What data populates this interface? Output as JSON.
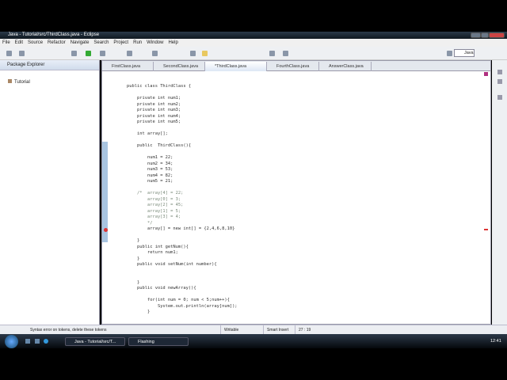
{
  "window": {
    "title": "Java - Tutorial/src/ThirdClass.java - Eclipse"
  },
  "menu": [
    "File",
    "Edit",
    "Source",
    "Refactor",
    "Navigate",
    "Search",
    "Project",
    "Run",
    "Window",
    "Help"
  ],
  "perspective": "Java",
  "package_explorer": {
    "title": "Package Explorer",
    "items": [
      "Tutorial"
    ]
  },
  "tabs": [
    "FirstClass.java",
    "SecondClass.java",
    "*ThirdClass.java",
    "FourthClass.java",
    "AnswerClass.java"
  ],
  "code": [
    "public class ThirdClass {",
    "",
    "    private int num1;",
    "    private int num2;",
    "    private int num3;",
    "    private int num4;",
    "    private int num5;",
    "",
    "    int array[];",
    "",
    "    public  ThirdClass(){",
    "",
    "        num1 = 22;",
    "        num2 = 34;",
    "        num3 = 53;",
    "        num4 = 82;",
    "        num5 = 21;",
    "",
    "    /*  array[4] = 22;",
    "        array[0] = 3;",
    "        array[2] = 45;",
    "        array[1] = 5;",
    "        array[3] = 4;",
    "        */",
    "        array[] = new int[] = {2,4,6,8,10}",
    "",
    "    }",
    "    public int getNum(){",
    "        return num1;",
    "    }",
    "    public void setNum(int number){",
    "",
    "",
    "    }",
    "    public void newArray(){",
    "",
    "        for(int num = 0; num < 5;num++){",
    "            System.out.println(array[num]);",
    "        }"
  ],
  "status": {
    "message": "Syntax error on tokens, delete these tokens",
    "writable": "Writable",
    "insert_mode": "Smart Insert",
    "position": "27 : 19"
  },
  "taskbar": {
    "tasks": [
      "Java - Tutorial/src/T...",
      "Flashing"
    ],
    "clock": "12:41"
  }
}
